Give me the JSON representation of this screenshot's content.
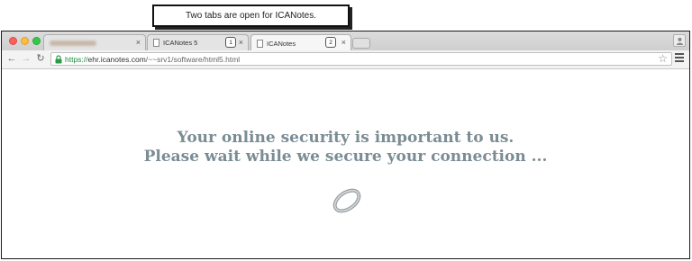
{
  "annotation": {
    "text": "Two tabs are open for ICANotes."
  },
  "tabs": [
    {
      "label": "",
      "blurred": true,
      "close": "×"
    },
    {
      "label": "ICANotes 5",
      "close": "×",
      "badge": "1"
    },
    {
      "label": "ICANotes",
      "close": "×",
      "badge": "2"
    }
  ],
  "toolbar": {
    "back": "←",
    "forward": "→",
    "reload": "↻",
    "url_scheme": "https://",
    "url_host": "ehr.icanotes.com",
    "url_path": "/~~srv1/software/html5.html",
    "star": "☆"
  },
  "page": {
    "line1": "Your online security is important to us.",
    "line2": "Please wait while we secure your connection ..."
  },
  "colors": {
    "message": "#7a8c94",
    "secure_green": "#1f8a3a"
  },
  "icons": [
    "close-window-dot",
    "minimize-dot",
    "zoom-dot",
    "page-icon",
    "lock-icon",
    "star-icon",
    "menu-icon",
    "profile-icon",
    "loading-ring-icon"
  ]
}
